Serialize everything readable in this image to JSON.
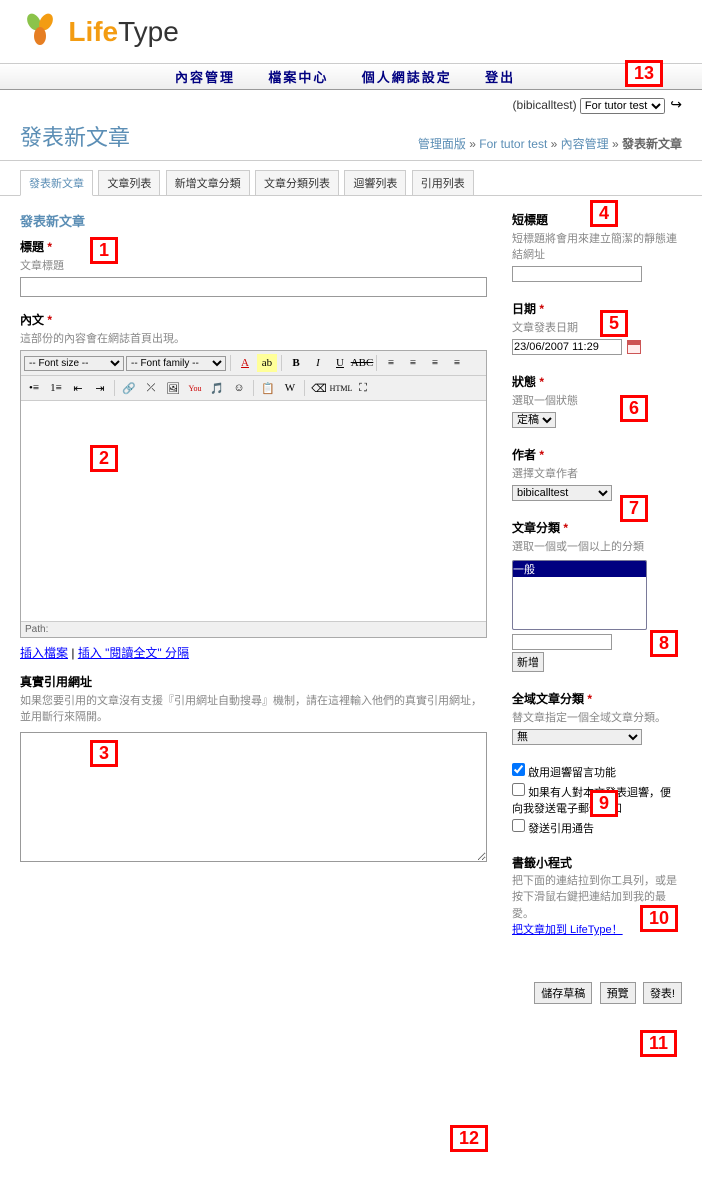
{
  "logo": {
    "life": "Life",
    "type": "Type"
  },
  "topnav": [
    "內容管理",
    "檔案中心",
    "個人網誌設定",
    "登出"
  ],
  "blogselect": {
    "user": "(bibicalltest)",
    "selected": "For tutor test"
  },
  "page_title": "發表新文章",
  "breadcrumb": {
    "a": "管理面版",
    "b": "For tutor test",
    "c": "內容管理",
    "d": "發表新文章"
  },
  "tabs": [
    "發表新文章",
    "文章列表",
    "新增文章分類",
    "文章分類列表",
    "迴響列表",
    "引用列表"
  ],
  "form": {
    "section": "發表新文章",
    "title_label": "標題",
    "title_help": "文章標題",
    "body_label": "內文",
    "body_help": "這部份的內容會在網誌首頁出現。",
    "fontsize_ph": "-- Font size --",
    "fontfamily_ph": "-- Font family --",
    "path": "Path:",
    "link_insert": "插入檔案",
    "link_more": "插入 \"閱讀全文\" 分隔",
    "tb_label": "真實引用網址",
    "tb_help": "如果您要引用的文章沒有支援『引用網址自動搜尋』機制，請在這裡輸入他們的真實引用網址，並用斷行來隔開。"
  },
  "side": {
    "slug_label": "短標題",
    "slug_help": "短標題將會用來建立簡潔的靜態連結網址",
    "date_label": "日期",
    "date_help": "文章發表日期",
    "date_val": "23/06/2007 11:29",
    "status_label": "狀態",
    "status_help": "選取一個狀態",
    "status_val": "定稿",
    "author_label": "作者",
    "author_help": "選擇文章作者",
    "author_val": "bibicalltest",
    "cat_label": "文章分類",
    "cat_help": "選取一個或一個以上的分類",
    "cat_opt": "一般",
    "cat_add": "新增",
    "gcat_label": "全域文章分類",
    "gcat_help": "替文章指定一個全域文章分類。",
    "gcat_val": "無",
    "chk1": "啟用迴響留言功能",
    "chk2": "如果有人對本文發表迴響，便向我發送電子郵件通知",
    "chk3": "發送引用通告",
    "bm_label": "書籤小程式",
    "bm_help": "把下面的連結拉到你工具列，或是按下滑鼠右鍵把連結加到我的最愛。",
    "bm_link": "把文章加到 LifeType！"
  },
  "buttons": {
    "draft": "儲存草稿",
    "preview": "預覽",
    "post": "發表!"
  },
  "annot": {
    "1": "1",
    "2": "2",
    "3": "3",
    "4": "4",
    "5": "5",
    "6": "6",
    "7": "7",
    "8": "8",
    "9": "9",
    "10": "10",
    "11": "11",
    "12": "12",
    "13": "13"
  }
}
